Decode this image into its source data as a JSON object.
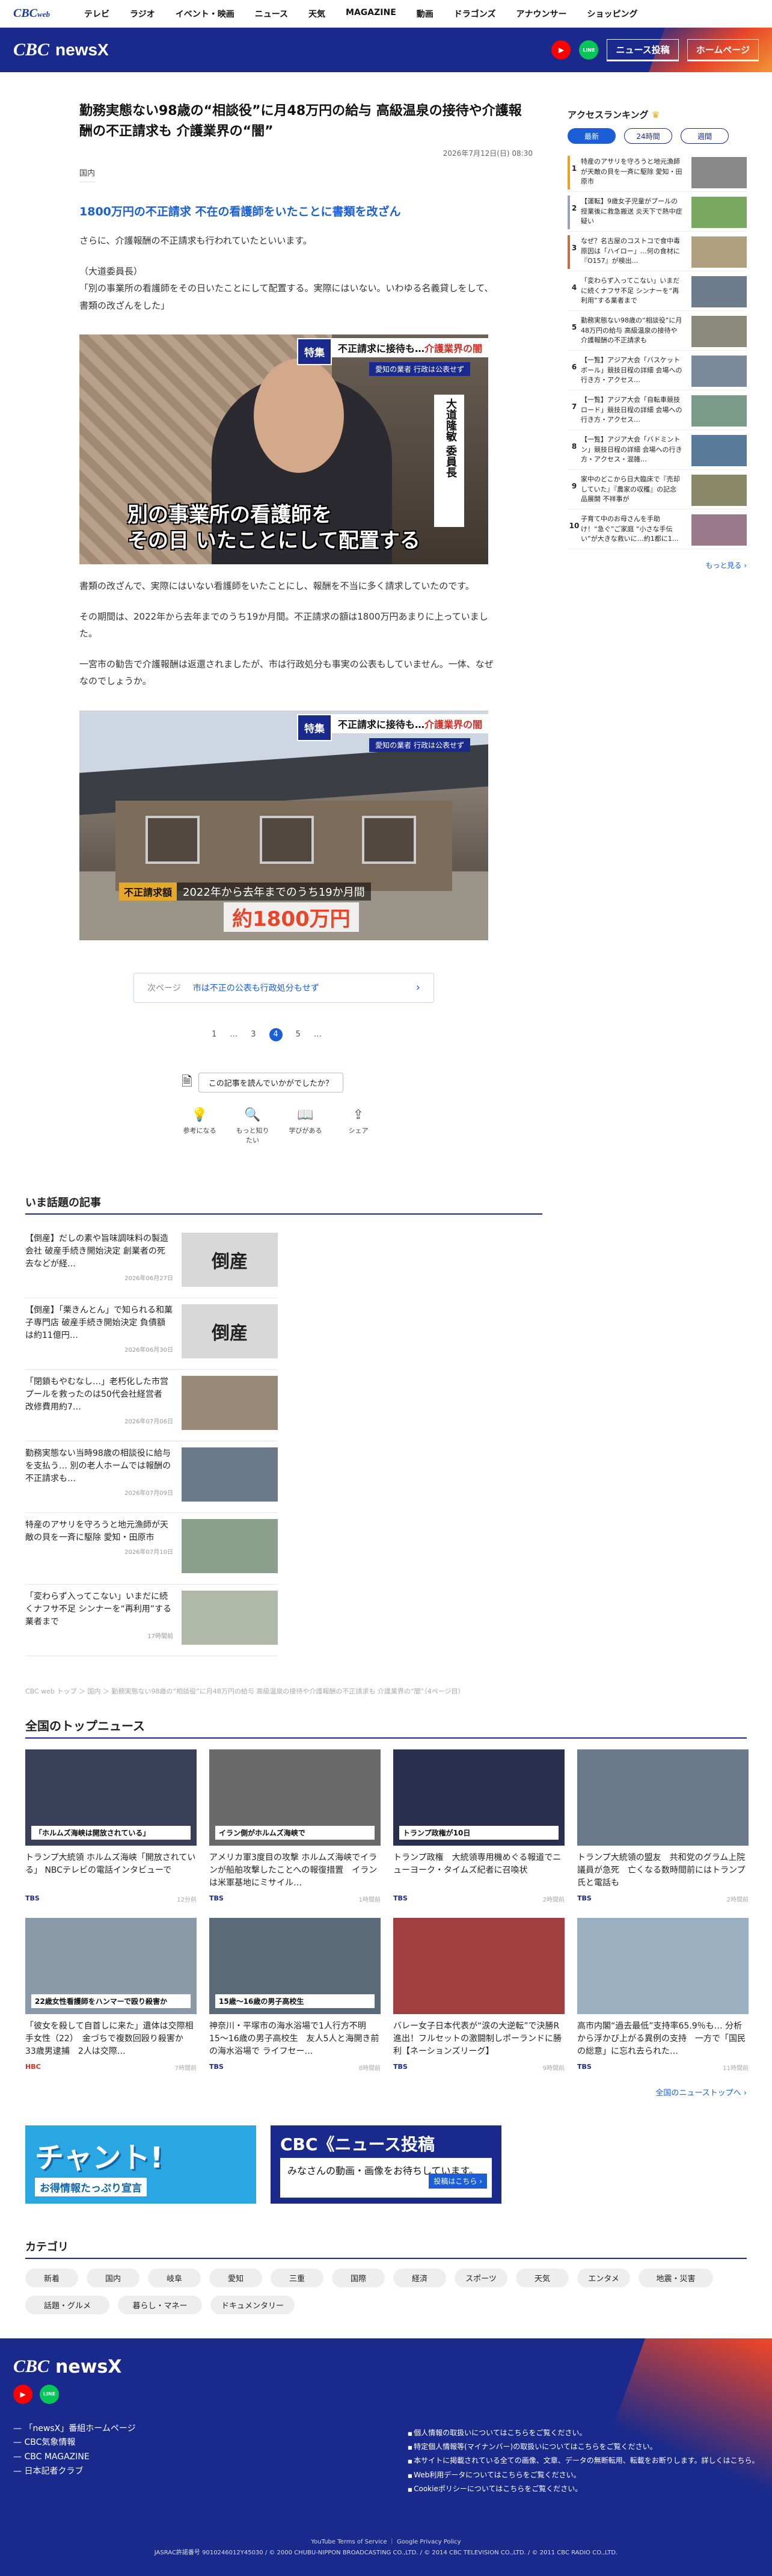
{
  "topnav": {
    "brand": "CBC",
    "brand_sub": "web",
    "items": [
      "テレビ",
      "ラジオ",
      "イベント・映画",
      "ニュース",
      "天気",
      "MAGAZINE",
      "動画",
      "ドラゴンズ",
      "アナウンサー",
      "ショッピング"
    ]
  },
  "header": {
    "logo_cbc": "CBC",
    "logo_newsx": "newsX",
    "yt": "▶",
    "line": "LINE",
    "post_btn": "ニュース投稿",
    "home_btn": "ホームページ"
  },
  "article": {
    "title": "勤務実態ない98歳の“相談役”に月48万円の給与 高級温泉の接待や介護報酬の不正請求も 介護業界の“闇”",
    "date": "2026年7月12日(日) 08:30",
    "category": "国内",
    "subhead": "1800万円の不正請求 不在の看護師をいたことに書類を改ざん",
    "p1": "さらに、介護報酬の不正請求も行われていたといいます。",
    "p2a": "（大道委員長）",
    "p2b": "「別の事業所の看護師をその日いたことにして配置する。実際にはいない。いわゆる名義貸しをして、書類の改ざんをした」",
    "p3": "書類の改ざんで、実際にはいない看護師をいたことにし、報酬を不当に多く請求していたのです。",
    "p4": "その期間は、2022年から去年までのうち19か月間。不正請求の額は1800万円あまりに上っていました。",
    "p5": "一宮市の勧告で介護報酬は返還されましたが、市は行政処分も事実の公表もしていません。一体、なぜなのでしょうか。",
    "photo1": {
      "tag_k": "特集",
      "tag_t1": "不正請求に接待も…",
      "tag_t2": "介護業界の闇",
      "tag_s": "愛知の業者 行政は公表せず",
      "name": "大道隆敏 委員長",
      "cap_l1": "別の事業所の看護師を",
      "cap_l2": "その日 いたことにして配置する"
    },
    "photo2": {
      "tag_k": "特集",
      "tag_t1": "不正請求に接待も…",
      "tag_t2": "介護業界の闇",
      "tag_s": "愛知の業者 行政は公表せず",
      "cap_r": "不正請求額",
      "cap_t": "2022年から去年までのうち19か月間",
      "cap_b": "約1800万円"
    },
    "next_label": "次ページ",
    "next_title": "市は不正の公表も行政処分もせず",
    "pager": [
      "1",
      "…",
      "3",
      "4",
      "5",
      "…"
    ],
    "ask": "この記事を読んでいかがでしたか？",
    "reacts": [
      {
        "ic": "💡",
        "t": "参考になる"
      },
      {
        "ic": "🔍",
        "t": "もっと知りたい"
      },
      {
        "ic": "📖",
        "t": "学びがある"
      },
      {
        "ic": "⇪",
        "t": "シェア"
      }
    ]
  },
  "topics": {
    "title": "いま話題の記事",
    "items": [
      {
        "t": "【倒産】だしの素や旨味調味料の製造会社 破産手続き開始決定 創業者の死去などが経…",
        "d": "2026年06月27日",
        "img": "倒産"
      },
      {
        "t": "【倒産】「栗きんとん」で知られる和菓子専門店 破産手続き開始決定 負債額は約11億円…",
        "d": "2026年06月30日",
        "img": "倒産"
      },
      {
        "t": "「閉鎖もやむなし…」老朽化した市営プールを救ったのは50代会社経営者 改修費用約7…",
        "d": "2026年07月06日",
        "img": ""
      },
      {
        "t": "勤務実態ない当時98歳の相談役に給与を支払う… 別の老人ホームでは報酬の不正請求も…",
        "d": "2026年07月09日",
        "img": ""
      },
      {
        "t": "特産のアサリを守ろうと地元漁師が天敵の貝を一斉に駆除 愛知・田原市",
        "d": "2026年07月10日",
        "img": ""
      },
      {
        "t": "「変わらず入ってこない」いまだに続くナフサ不足 シンナーを“再利用”する業者まで",
        "d": "17時間前",
        "img": ""
      }
    ]
  },
  "breadcrumb": "CBC web トップ ＞ 国内 ＞ 勤務実態ない98歳の“相談役”に月48万円の給与 高級温泉の接待や介護報酬の不正請求も 介護業界の“闇”（4ページ目）",
  "national": {
    "title": "全国のトップニュース",
    "items": [
      {
        "t": "トランプ大統領 ホルムズ海峡「開放されている」 NBCテレビの電話インタビューで",
        "s": "TBS",
        "a": "12分前",
        "c": "#3a3f5a",
        "cap": "「ホルムズ海峡は開放されている」"
      },
      {
        "t": "アメリカ軍3度目の攻撃 ホルムズ海峡でイランが船舶攻撃したことへの報復措置　イランは米軍基地にミサイル…",
        "s": "TBS",
        "a": "1時間前",
        "c": "#6a6a6a",
        "cap": "イラン側がホルムズ海峡で"
      },
      {
        "t": "トランプ政権　大統領専用機めぐる報道でニューヨーク・タイムズ紀者に召喚状",
        "s": "TBS",
        "a": "2時間前",
        "c": "#2a3050",
        "cap": "トランプ政権が10日"
      },
      {
        "t": "トランプ大統領の盟友　共和党のグラム上院議員が急死　亡くなる数時間前にはトランプ氏と電話も",
        "s": "TBS",
        "a": "2時間前",
        "c": "#6a7a8a",
        "cap": ""
      },
      {
        "t": "「彼女を殺して自首しに来た」遺体は交際相手女性（22）　金づちで複数回殴り殺害か　33歳男逮捕　2人は交際…",
        "s": "HBC",
        "a": "7時間前",
        "c": "#8a9aa8",
        "cap": "22歳女性看護師をハンマーで殴り殺害か"
      },
      {
        "t": "神奈川・平塚市の海水浴場で1人行方不明　15～16歳の男子高校生　友人5人と海開き前の海水浴場で ライフセー…",
        "s": "TBS",
        "a": "8時間前",
        "c": "#5a6a78",
        "cap": "15歳～16歳の男子高校生"
      },
      {
        "t": "バレー女子日本代表が“涙の大逆転”で決勝R進出！フルセットの激闘制しポーランドに勝利【ネーションズリーグ】",
        "s": "TBS",
        "a": "9時間前",
        "c": "#a04040",
        "cap": ""
      },
      {
        "t": "高市内閣“過去最低”支持率65.9％も… 分析から浮かび上がる異例の支持　一方で「国民の総意」に忘れ去られた…",
        "s": "TBS",
        "a": "11時間前",
        "c": "#9ab0c0",
        "cap": ""
      }
    ]
  },
  "more_news": "全国のニューストップへ ›",
  "banner1": {
    "big": "チャント!",
    "sm": "お得情報たっぷり宣言"
  },
  "banner2": {
    "t1": "CBC《ニュース投稿",
    "t2": "みなさんの動画・画像をお待ちしています。",
    "t3": "投稿はこちら ›"
  },
  "categories": {
    "title": "カテゴリ",
    "items": [
      "新着",
      "国内",
      "岐阜",
      "愛知",
      "三重",
      "国際",
      "経済",
      "スポーツ",
      "天気",
      "エンタメ",
      "地震・災害",
      "話題・グルメ",
      "暮らし・マネー",
      "ドキュメンタリー"
    ]
  },
  "footer": {
    "links": [
      "「newsX」番組ホームページ",
      "CBC気象情報",
      "CBC MAGAZINE",
      "日本記者クラブ"
    ],
    "policy": [
      "個人情報の取扱いについてはこちらをご覧ください。",
      "特定個人情報等(マイナンバー)の取扱いについてはこちらをご覧ください。",
      "本サイトに掲載されている全ての画像、文章、データの無断転用、転載をお断りします。詳しくはこちら。",
      "Web利用データについてはこちらをご覧ください。",
      "Cookieポリシーについてはこちらをご覧ください。"
    ],
    "policy2": "YouTube Terms of Service ｜ Google Privacy Policy",
    "copy": "JASRAC許諾番号 9010246012Y45030 / © 2000 CHUBU-NIPPON BROADCASTING CO.,LTD. / © 2014 CBC TELEVISION CO.,LTD. / © 2011 CBC RADIO CO.,LTD."
  },
  "side": {
    "title": "アクセスランキング",
    "tabs": [
      "最新",
      "24時間",
      "週間"
    ],
    "items": [
      {
        "n": "1",
        "t": "特産のアサリを守ろうと地元漁師が天敵の貝を一斉に駆除 愛知・田原市",
        "c": "#f0a020",
        "ic": "#888"
      },
      {
        "n": "2",
        "t": "【運転】9歳女子児童がプールの授業後に救急搬送 炎天下で熱中症疑い",
        "c": "#9aa0b8",
        "ic": "#7aa860"
      },
      {
        "n": "3",
        "t": "なぜ？名古屋のコストコで食中毒 原因は「ハイロー」…何の食材に『O157』が検出…",
        "c": "#c07040",
        "ic": "#b0a080"
      },
      {
        "n": "4",
        "t": "「変わらず入ってこない」いまだに続くナフサ不足 シンナーを“再利用”する業者まで",
        "c": "#fff",
        "ic": "#6c7c8c"
      },
      {
        "n": "5",
        "t": "勤務実態ない98歳の“相談役”に月48万円の給与 高級温泉の接待や介護報酬の不正請求も",
        "c": "#fff",
        "ic": "#8a8a7a"
      },
      {
        "n": "6",
        "t": "【一覧】アジア大会「バスケットボール」競技日程の詳細 会場への行き方・アクセス…",
        "c": "#fff",
        "ic": "#7a8a9a"
      },
      {
        "n": "7",
        "t": "【一覧】アジア大会「自転車競技 ロード」競技日程の詳細 会場への行き方・アクセス…",
        "c": "#fff",
        "ic": "#7a9a8a"
      },
      {
        "n": "8",
        "t": "【一覧】アジア大会「バドミントン」競技日程の詳細 会場への行き方・アクセス・混雑…",
        "c": "#fff",
        "ic": "#5a7a9a"
      },
      {
        "n": "9",
        "t": "家中のどこから日大臨床で『売却していた』『農家の収穫』の記念品展開 不祥事が",
        "c": "#fff",
        "ic": "#8a8a6a"
      },
      {
        "n": "10",
        "t": "子育て中のお母さんを手助け！“急ぐ”ご家庭 “小さな手伝い”が大きな救いに…約1都に1…",
        "c": "#fff",
        "ic": "#9a7a8a"
      }
    ],
    "more": "もっと見る ›"
  }
}
